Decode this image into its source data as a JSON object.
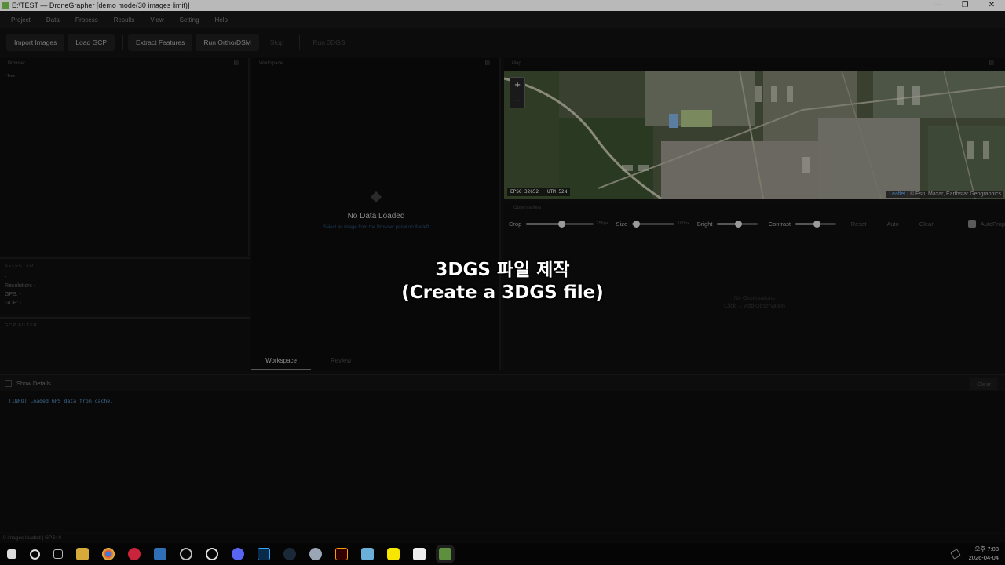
{
  "window": {
    "title": "E:\\TEST — DroneGrapher  [demo mode(30 images limit)]",
    "minimize": "—",
    "maximize": "❐",
    "close": "✕"
  },
  "menu": [
    "Project",
    "Data",
    "Process",
    "Results",
    "View",
    "Setting",
    "Help"
  ],
  "toolbar": {
    "import_images": "Import Images",
    "load_gcp": "Load GCP",
    "extract_features": "Extract Features",
    "run_ortho": "Run Ortho/DSM",
    "stop": "Stop",
    "run_3dgs": "Run 3DGS"
  },
  "browser": {
    "title": "Browser",
    "tree_root": "◦ Tree"
  },
  "selected": {
    "title": "SELECTED",
    "name": "-",
    "resolution": "Resolution: -",
    "gps": "GPS: -",
    "gcp": "GCP: -"
  },
  "gcp_filter": {
    "title": "GCP FILTER"
  },
  "workspace": {
    "title": "Workspace",
    "empty_title": "No Data Loaded",
    "empty_hint": "Select an image from the Browser panel on the left",
    "tabs": [
      "Workspace",
      "Review"
    ],
    "active_tab": "Workspace"
  },
  "map": {
    "title": "Map",
    "zoom_in": "+",
    "zoom_out": "−",
    "epsg": "EPSG 32652 | UTM 52N",
    "attribution_leaflet": "Leaflet",
    "attribution_rest": " | © Esri, Maxar, Earthstar Geographics"
  },
  "observations": {
    "title": "Observations",
    "crop": {
      "label": "Crop",
      "value": "256px",
      "level": 0.5
    },
    "size": {
      "label": "Size",
      "value": "180px",
      "level": 0.1
    },
    "bright": {
      "label": "Bright",
      "level": 0.5
    },
    "contrast": {
      "label": "Contrast",
      "level": 0.5
    },
    "reset": "Reset",
    "auto": "Auto",
    "clear": "Clear",
    "autoprop": "AutoProp",
    "empty_title": "No Observations",
    "empty_hint": "Click → Add Observation"
  },
  "overlay": {
    "line1": "3DGS 파일 제작",
    "line2": "(Create a 3DGS file)"
  },
  "log": {
    "show_details": "Show Details",
    "clear": "Clear",
    "lines": [
      "[INFO] Loaded GPS data from cache."
    ]
  },
  "status": "0 images loaded | GPS: 0",
  "taskbar": {
    "icons": [
      "windows-start-icon",
      "search-icon",
      "task-view-icon",
      "file-explorer-icon",
      "chrome-icon",
      "media-player-icon",
      "virtualbox-icon",
      "app-icon",
      "chat-icon",
      "discord-icon",
      "photoshop-icon",
      "steam-icon",
      "ai-app-icon",
      "illustrator-icon",
      "notepad-icon",
      "kakaotalk-icon",
      "capcut-icon",
      "dronegrapher-icon"
    ],
    "time": "오후 7:03",
    "date": "2026-04-04"
  },
  "colors": {
    "accent": "#3d6a8f",
    "map_bg": "#27301f"
  }
}
